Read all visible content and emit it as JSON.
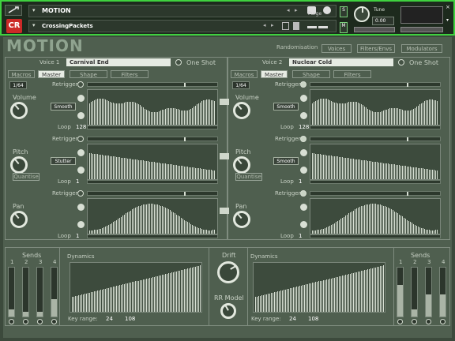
{
  "header": {
    "instrument_name": "MOTION",
    "snapshot_name": "CrossingPackets",
    "logo": "CR",
    "purge_label": "Purge",
    "tune_label": "Tune",
    "tune_value": "0.00"
  },
  "title": "MOTION",
  "randomisation": {
    "label": "Randomisation",
    "buttons": [
      "Voices",
      "Filters/Envs",
      "Modulators"
    ]
  },
  "voices": [
    {
      "label": "Voice 1",
      "preset": "Carnival End",
      "oneshot": "One Shot",
      "tabs": [
        "Macros",
        "Master",
        "Shape",
        "Filters"
      ],
      "active_tab": "Master",
      "rate": "1/64",
      "rows": [
        {
          "knob": "Volume",
          "mode": "Smooth",
          "retrigger": "Retrigger",
          "loop_label": "Loop",
          "loop_value": "128",
          "shape": "hump"
        },
        {
          "knob": "Pitch",
          "mode": "Stutter",
          "retrigger": "Retrigger",
          "loop_label": "Loop",
          "loop_value": "1",
          "shape": "down",
          "extra": "Quantise"
        },
        {
          "knob": "Pan",
          "mode": "",
          "retrigger": "Retrigger",
          "loop_label": "Loop",
          "loop_value": "1",
          "shape": "sine"
        }
      ]
    },
    {
      "label": "Voice 2",
      "preset": "Nuclear Cold",
      "oneshot": "One Shot",
      "tabs": [
        "Macros",
        "Master",
        "Shape",
        "Filters"
      ],
      "active_tab": "Master",
      "rate": "1/64",
      "rows": [
        {
          "knob": "Volume",
          "mode": "Smooth",
          "retrigger": "Retrigger",
          "loop_label": "Loop",
          "loop_value": "128",
          "shape": "hump"
        },
        {
          "knob": "Pitch",
          "mode": "Smooth",
          "retrigger": "Retrigger",
          "loop_label": "Loop",
          "loop_value": "1",
          "shape": "down",
          "extra": "Quantise"
        },
        {
          "knob": "Pan",
          "mode": "",
          "retrigger": "Retrigger",
          "loop_label": "Loop",
          "loop_value": "1",
          "shape": "sine"
        }
      ]
    }
  ],
  "bottom": {
    "sends_left": {
      "label": "Sends",
      "numbers": [
        "1",
        "2",
        "3",
        "4"
      ],
      "levels": [
        0.15,
        0.1,
        0.1,
        0.35
      ]
    },
    "sends_right": {
      "label": "Sends",
      "numbers": [
        "1",
        "2",
        "3",
        "4"
      ],
      "levels": [
        0.65,
        0.15,
        0.45,
        0.45
      ]
    },
    "dynamics_left": {
      "label": "Dynamics",
      "key_range_label": "Key range:",
      "key_low": "24",
      "key_high": "108"
    },
    "dynamics_right": {
      "label": "Dynamics",
      "key_range_label": "Key range:",
      "key_low": "24",
      "key_high": "108"
    },
    "drift_label": "Drift",
    "rr_label": "RR Model"
  }
}
